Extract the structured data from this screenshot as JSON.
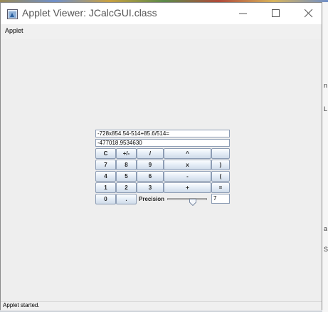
{
  "window": {
    "title": "Applet Viewer: JCalcGUI.class",
    "menu": [
      "Applet"
    ],
    "status": "Applet started."
  },
  "calculator": {
    "expression": "-728x854.54-514+85.6/514=",
    "result": "-477018.9534630",
    "rows": [
      [
        "C",
        "+/-",
        "/",
        "^",
        ""
      ],
      [
        "7",
        "8",
        "9",
        "x",
        ")"
      ],
      [
        "4",
        "5",
        "6",
        "-",
        "("
      ],
      [
        "1",
        "2",
        "3",
        "+",
        "="
      ],
      [
        "0",
        "."
      ]
    ],
    "precision_label": "Precision",
    "precision_value": "7",
    "precision_slider_fraction": 0.65
  },
  "background_fragments": [
    "n",
    "L",
    "a",
    "S"
  ]
}
